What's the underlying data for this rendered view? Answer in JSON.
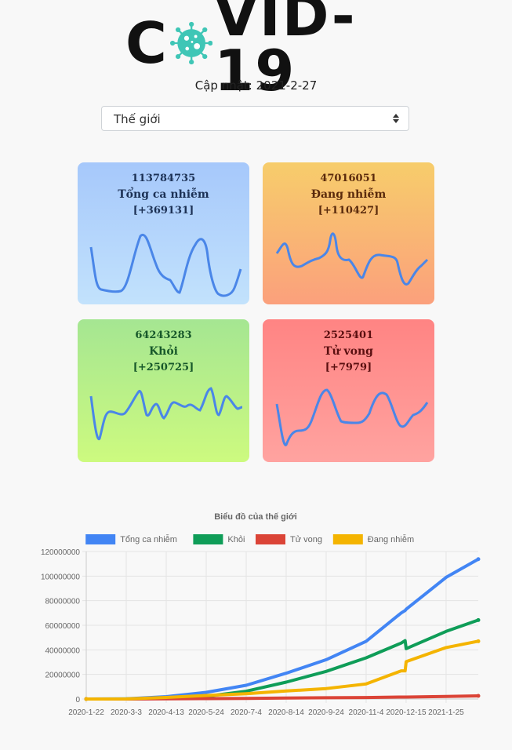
{
  "logo": {
    "left": "C",
    "right": "VID-19",
    "virus_icon": "virus-icon",
    "virus_color": "#3fc6b6"
  },
  "updated_label": "Cập nhật: 2021-2-27",
  "region_select": {
    "value": "Thế giới",
    "arrow_icon": "sort-arrows-icon"
  },
  "cards": [
    {
      "number": "113784735",
      "label": "Tổng ca nhiễm",
      "delta": "[+369131]",
      "line_color": "#4a86e8"
    },
    {
      "number": "47016051",
      "label": "Đang nhiễm",
      "delta": "[+110427]",
      "line_color": "#4a86e8"
    },
    {
      "number": "64243283",
      "label": "Khỏi",
      "delta": "[+250725]",
      "line_color": "#4a86e8"
    },
    {
      "number": "2525401",
      "label": "Tử vong",
      "delta": "[+7979]",
      "line_color": "#4a86e8"
    }
  ],
  "chart_data": {
    "type": "line",
    "title": "Biểu đồ của thế giới",
    "legend_position": "top",
    "grid": true,
    "ylim": [
      0,
      120000000
    ],
    "yticks": [
      "120000000",
      "100000000",
      "80000000",
      "60000000",
      "40000000",
      "20000000",
      "0"
    ],
    "xticks": [
      "2020-1-22",
      "2020-3-3",
      "2020-4-13",
      "2020-5-24",
      "2020-7-4",
      "2020-8-14",
      "2020-9-24",
      "2020-11-4",
      "2020-12-15",
      "2021-1-25"
    ],
    "x": [
      "2020-1-22",
      "2020-3-3",
      "2020-4-13",
      "2020-5-24",
      "2020-7-4",
      "2020-8-14",
      "2020-9-24",
      "2020-11-4",
      "2020-12-10",
      "2020-12-14",
      "2020-12-15",
      "2021-1-25",
      "2021-2-27"
    ],
    "series": [
      {
        "name": "Tổng ca nhiễm",
        "color": "#4285f4",
        "values": [
          555,
          100000,
          1900000,
          5400000,
          11200000,
          21000000,
          32000000,
          47000000,
          70000000,
          72000000,
          73000000,
          99000000,
          113784735
        ]
      },
      {
        "name": "Khỏi",
        "color": "#0f9d58",
        "values": [
          28,
          40000,
          500000,
          2200000,
          6300000,
          13700000,
          22500000,
          33500000,
          45500000,
          47500000,
          41000000,
          55000000,
          64243283
        ]
      },
      {
        "name": "Tử vong",
        "color": "#db4437",
        "values": [
          17,
          3000,
          120000,
          350000,
          530000,
          760000,
          990000,
          1240000,
          1570000,
          1600000,
          1610000,
          2130000,
          2525401
        ]
      },
      {
        "name": "Đang nhiễm",
        "color": "#f4b400",
        "values": [
          510,
          57000,
          1280000,
          2850000,
          4370000,
          6540000,
          8510000,
          12260000,
          22930000,
          22900000,
          30390000,
          41870000,
          47016051
        ]
      }
    ]
  }
}
